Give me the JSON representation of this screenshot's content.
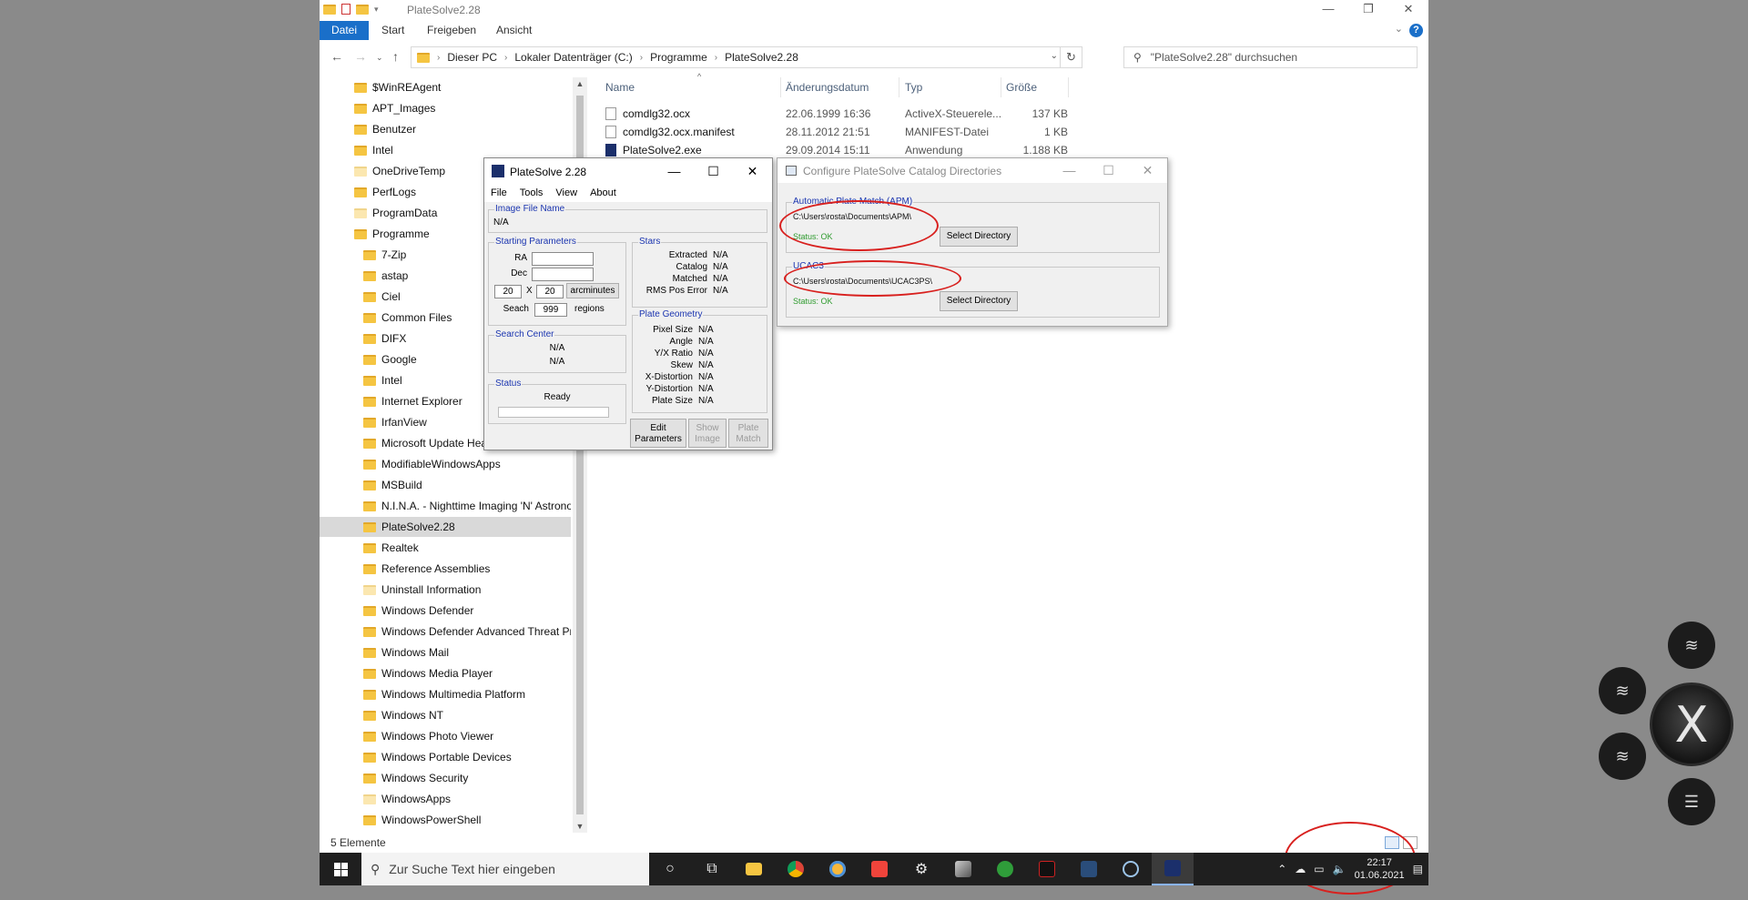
{
  "explorer": {
    "title": "PlateSolve2.28",
    "ribbon_tabs": [
      "Datei",
      "Start",
      "Freigeben",
      "Ansicht"
    ],
    "breadcrumb": [
      "Dieser PC",
      "Lokaler Datenträger (C:)",
      "Programme",
      "PlateSolve2.28"
    ],
    "search_placeholder": "\"PlateSolve2.28\" durchsuchen",
    "nav_items": [
      {
        "label": "$WinREAgent",
        "indent": 0,
        "pale": false
      },
      {
        "label": "APT_Images",
        "indent": 0,
        "pale": false
      },
      {
        "label": "Benutzer",
        "indent": 0,
        "pale": false
      },
      {
        "label": "Intel",
        "indent": 0,
        "pale": false
      },
      {
        "label": "OneDriveTemp",
        "indent": 0,
        "pale": true
      },
      {
        "label": "PerfLogs",
        "indent": 0,
        "pale": false
      },
      {
        "label": "ProgramData",
        "indent": 0,
        "pale": true
      },
      {
        "label": "Programme",
        "indent": 0,
        "pale": false
      },
      {
        "label": "7-Zip",
        "indent": 1,
        "pale": false
      },
      {
        "label": "astap",
        "indent": 1,
        "pale": false
      },
      {
        "label": "Ciel",
        "indent": 1,
        "pale": false
      },
      {
        "label": "Common Files",
        "indent": 1,
        "pale": false
      },
      {
        "label": "DIFX",
        "indent": 1,
        "pale": false
      },
      {
        "label": "Google",
        "indent": 1,
        "pale": false
      },
      {
        "label": "Intel",
        "indent": 1,
        "pale": false
      },
      {
        "label": "Internet Explorer",
        "indent": 1,
        "pale": false
      },
      {
        "label": "IrfanView",
        "indent": 1,
        "pale": false
      },
      {
        "label": "Microsoft Update Health Tools",
        "indent": 1,
        "pale": false
      },
      {
        "label": "ModifiableWindowsApps",
        "indent": 1,
        "pale": false
      },
      {
        "label": "MSBuild",
        "indent": 1,
        "pale": false
      },
      {
        "label": "N.I.N.A. - Nighttime Imaging 'N' Astronomy",
        "indent": 1,
        "pale": false
      },
      {
        "label": "PlateSolve2.28",
        "indent": 1,
        "pale": false,
        "selected": true
      },
      {
        "label": "Realtek",
        "indent": 1,
        "pale": false
      },
      {
        "label": "Reference Assemblies",
        "indent": 1,
        "pale": false
      },
      {
        "label": "Uninstall Information",
        "indent": 1,
        "pale": true
      },
      {
        "label": "Windows Defender",
        "indent": 1,
        "pale": false
      },
      {
        "label": "Windows Defender Advanced Threat Protection",
        "indent": 1,
        "pale": false
      },
      {
        "label": "Windows Mail",
        "indent": 1,
        "pale": false
      },
      {
        "label": "Windows Media Player",
        "indent": 1,
        "pale": false
      },
      {
        "label": "Windows Multimedia Platform",
        "indent": 1,
        "pale": false
      },
      {
        "label": "Windows NT",
        "indent": 1,
        "pale": false
      },
      {
        "label": "Windows Photo Viewer",
        "indent": 1,
        "pale": false
      },
      {
        "label": "Windows Portable Devices",
        "indent": 1,
        "pale": false
      },
      {
        "label": "Windows Security",
        "indent": 1,
        "pale": false
      },
      {
        "label": "WindowsApps",
        "indent": 1,
        "pale": true
      },
      {
        "label": "WindowsPowerShell",
        "indent": 1,
        "pale": false
      }
    ],
    "columns": [
      "Name",
      "Änderungsdatum",
      "Typ",
      "Größe"
    ],
    "files": [
      {
        "name": "comdlg32.ocx",
        "date": "22.06.1999 16:36",
        "type": "ActiveX-Steuerele...",
        "size": "137 KB",
        "icon": "ocx-file-icon"
      },
      {
        "name": "comdlg32.ocx.manifest",
        "date": "28.11.2012 21:51",
        "type": "MANIFEST-Datei",
        "size": "1 KB",
        "icon": "manifest-file-icon"
      },
      {
        "name": "PlateSolve2.exe",
        "date": "29.09.2014 15:11",
        "type": "Anwendung",
        "size": "1.188 KB",
        "icon": "exe-file-icon"
      }
    ],
    "status": "5 Elemente"
  },
  "platesolve": {
    "title": "PlateSolve 2.28",
    "menu": [
      "File",
      "Tools",
      "View",
      "About"
    ],
    "image_file_name_label": "Image File Name",
    "image_file_name": "N/A",
    "starting_parameters_label": "Starting Parameters",
    "ra_label": "RA",
    "dec_label": "Dec",
    "fov_w": "20",
    "fov_x": "X",
    "fov_h": "20",
    "arcminutes_label": "arcminutes",
    "search_label": "Seach",
    "search_value": "999",
    "regions_label": "regions",
    "search_center_label": "Search Center",
    "search_center_ra": "N/A",
    "search_center_dec": "N/A",
    "status_label": "Status",
    "status_value": "Ready",
    "stars_label": "Stars",
    "stars": [
      {
        "label": "Extracted",
        "value": "N/A"
      },
      {
        "label": "Catalog",
        "value": "N/A"
      },
      {
        "label": "Matched",
        "value": "N/A"
      },
      {
        "label": "RMS Pos Error",
        "value": "N/A"
      }
    ],
    "plate_geometry_label": "Plate Geometry",
    "geometry": [
      {
        "label": "Pixel Size",
        "value": "N/A"
      },
      {
        "label": "Angle",
        "value": "N/A"
      },
      {
        "label": "Y/X Ratio",
        "value": "N/A"
      },
      {
        "label": "Skew",
        "value": "N/A"
      },
      {
        "label": "X-Distortion",
        "value": "N/A"
      },
      {
        "label": "Y-Distortion",
        "value": "N/A"
      },
      {
        "label": "Plate Size",
        "value": "N/A"
      }
    ],
    "btn_edit": [
      "Edit",
      "Parameters"
    ],
    "btn_show": [
      "Show",
      "Image"
    ],
    "btn_plate": [
      "Plate",
      "Match"
    ]
  },
  "configure": {
    "title": "Configure PlateSolve Catalog Directories",
    "apm_label": "Automatic Plate Match (APM)",
    "apm_path": "C:\\Users\\rosta\\Documents\\APM\\",
    "apm_status": "Status: OK",
    "ucac3_label": "UCAC3",
    "ucac3_path": "C:\\Users\\rosta\\Documents\\UCAC3PS\\",
    "ucac3_status": "Status: OK",
    "select_dir_label": "Select Directory"
  },
  "taskbar": {
    "search_placeholder": "Zur Suche Text hier eingeben",
    "time": "22:17",
    "date": "01.06.2021",
    "apps": [
      "cortana-icon",
      "task-view-icon",
      "file-explorer-icon",
      "chrome-icon",
      "app-sun-icon",
      "anydesk-icon",
      "settings-icon",
      "app-telescope-icon",
      "app-green-icon",
      "app-sharpcap-icon",
      "app-network-icon",
      "app-orbit-icon",
      "platesolve-icon"
    ]
  },
  "colors": {
    "accent": "#1a6fc9",
    "annotation": "#d8201e",
    "group_label": "#1c36b0",
    "status_ok": "#2e9b2e"
  }
}
